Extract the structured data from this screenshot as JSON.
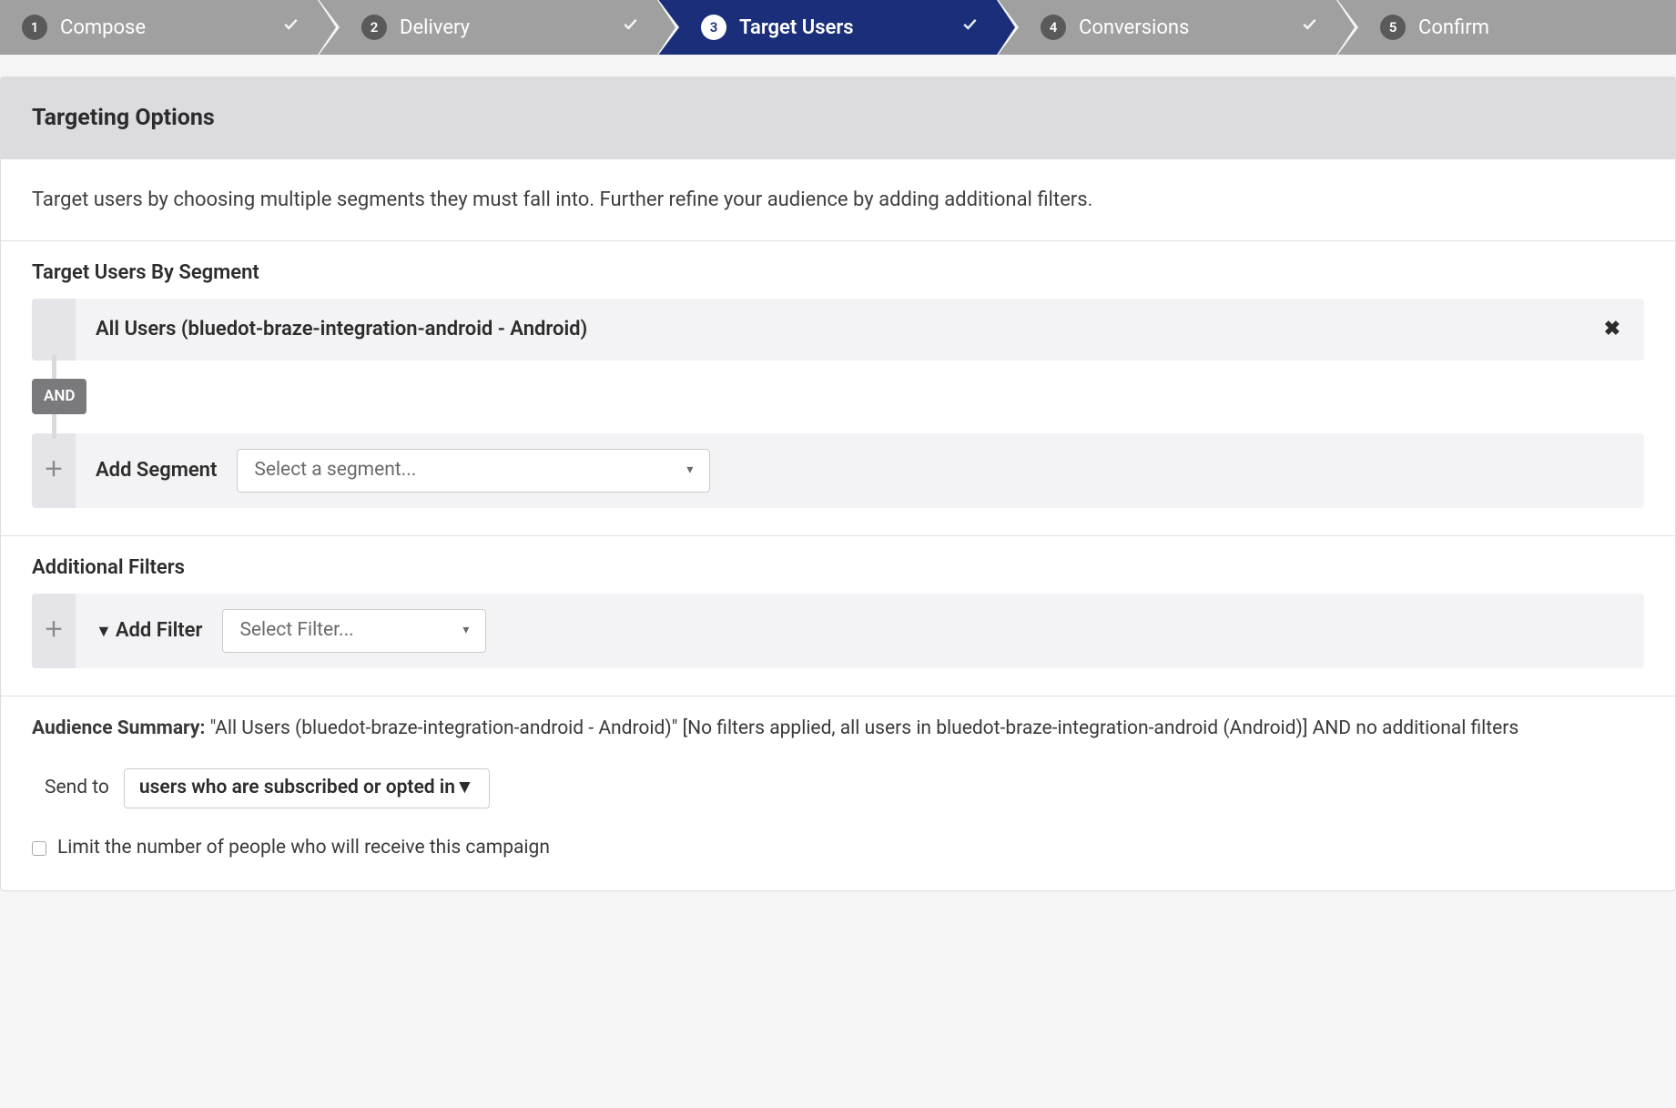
{
  "wizard": {
    "steps": [
      {
        "num": "1",
        "label": "Compose",
        "done": true,
        "active": false
      },
      {
        "num": "2",
        "label": "Delivery",
        "done": true,
        "active": false
      },
      {
        "num": "3",
        "label": "Target Users",
        "done": true,
        "active": true
      },
      {
        "num": "4",
        "label": "Conversions",
        "done": true,
        "active": false
      },
      {
        "num": "5",
        "label": "Confirm",
        "done": false,
        "active": false
      }
    ]
  },
  "panel": {
    "header": "Targeting Options",
    "description": "Target users by choosing multiple segments they must fall into. Further refine your audience by adding additional filters."
  },
  "segments": {
    "title": "Target Users By Segment",
    "selected": "All Users (bluedot-braze-integration-android - Android)",
    "connector": "AND",
    "add_label": "Add Segment",
    "add_placeholder": "Select a segment..."
  },
  "filters": {
    "title": "Additional Filters",
    "add_label": "Add Filter",
    "add_placeholder": "Select Filter..."
  },
  "summary": {
    "label": "Audience Summary:",
    "text": "\"All Users (bluedot-braze-integration-android - Android)\" [No filters applied, all users in bluedot-braze-integration-android (Android)] AND no additional filters"
  },
  "send_to": {
    "label": "Send to",
    "value": "users who are subscribed or opted in"
  },
  "limit": {
    "checked": false,
    "label": "Limit the number of people who will receive this campaign"
  }
}
